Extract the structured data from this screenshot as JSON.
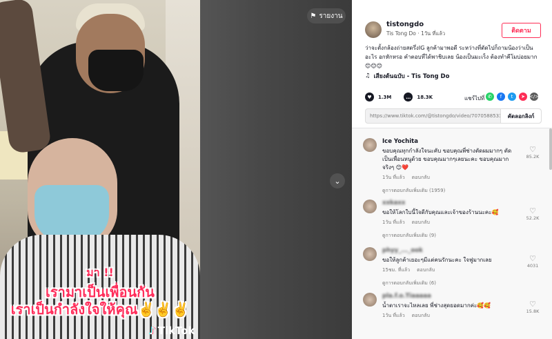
{
  "video": {
    "overlay_line1": "มา !!",
    "overlay_line2": "เรามาเป็นเพื่อนกัน",
    "overlay_line3": "เราเป็นกำลังใจให้คุณ✌️✌️✌️",
    "watermark": "TikTok",
    "report_label": "รายงาน"
  },
  "author": {
    "username": "tistongdo",
    "display_name": "Tis Tong Do",
    "posted_ago": "1วัน ที่แล้ว",
    "follow_label": "ติดตาม"
  },
  "caption": "ว่าจะตั้งกล้องถ่ายสดรึ่งIG ลูกค้ามาพอดี ระหว่างที่ตัดไปก็ถามน้องว่าเป็นอะไร อกหักหรอ คำตอบที่ได้พาชิบเลย น้องเป็นมะเร็ง ต้องทำคีโมบ่อยมาก 😊😊😊",
  "music": "เสียงต้นฉบับ - Tis Tong Do",
  "stats": {
    "likes": "1.3M",
    "comments": "18.3K"
  },
  "share": {
    "label": "แชร์ไปที่",
    "icons": [
      "whatsapp-icon",
      "facebook-icon",
      "twitter-icon",
      "telegram-icon",
      "embed-icon"
    ],
    "colors": {
      "whatsapp": "#25d366",
      "facebook": "#1877f2",
      "twitter": "#1d9bf0",
      "telegram": "#fe2c55",
      "embed": "#5c5c5c"
    }
  },
  "url": {
    "value": "https://www.tiktok.com/@tistongdo/video/707058853331...",
    "copy_label": "คัดลอกลิงก์"
  },
  "comments": [
    {
      "name": "Ice Yochita",
      "text": "ขอบคุณทุกกำลังใจนะคับ ขอบคุณพี่ช่างตัดผมมากๆ ตัดเป็นเพื่อนหนูด้วย ขอบคุณมากๆเลยนะคะ ขอบคุณมากจริงๆ 😊❤️",
      "time": "1วัน ที่แล้ว",
      "reply": "ตอบกลับ",
      "likes": "85.2K",
      "more": "ดูการตอบกลับเพิ่มเติม (1959)"
    },
    {
      "name": "xxkaxx",
      "text": "ขอให้โลกใบนี้ใจดีกับคุณและเจ้าของร้านนะคะ🥰",
      "time": "1วัน ที่แล้ว",
      "reply": "ตอบกลับ",
      "likes": "52.2K",
      "more": "ดูการตอบกลับเพิ่มเติม (9)"
    },
    {
      "name": "phyy_..._ook",
      "text": "ขอให้ลูกค้าเยอะๆมีแต่คนรักนะคะ ใจฟูมากเลย",
      "time": "15ชม. ที่แล้ว",
      "reply": "ตอบกลับ",
      "likes": "4031",
      "more": "ดูการตอบกลับเพิ่มเติม (6)"
    },
    {
      "name": "pla.f.o.Tiaaaaa",
      "text": "น้ำตาเราจะไหลเลย พี่ช่างสุดยอดมากค่ะ🥰🥰",
      "time": "1วัน ที่แล้ว",
      "reply": "ตอบกลับ",
      "likes": "15.8K",
      "more": ""
    }
  ]
}
